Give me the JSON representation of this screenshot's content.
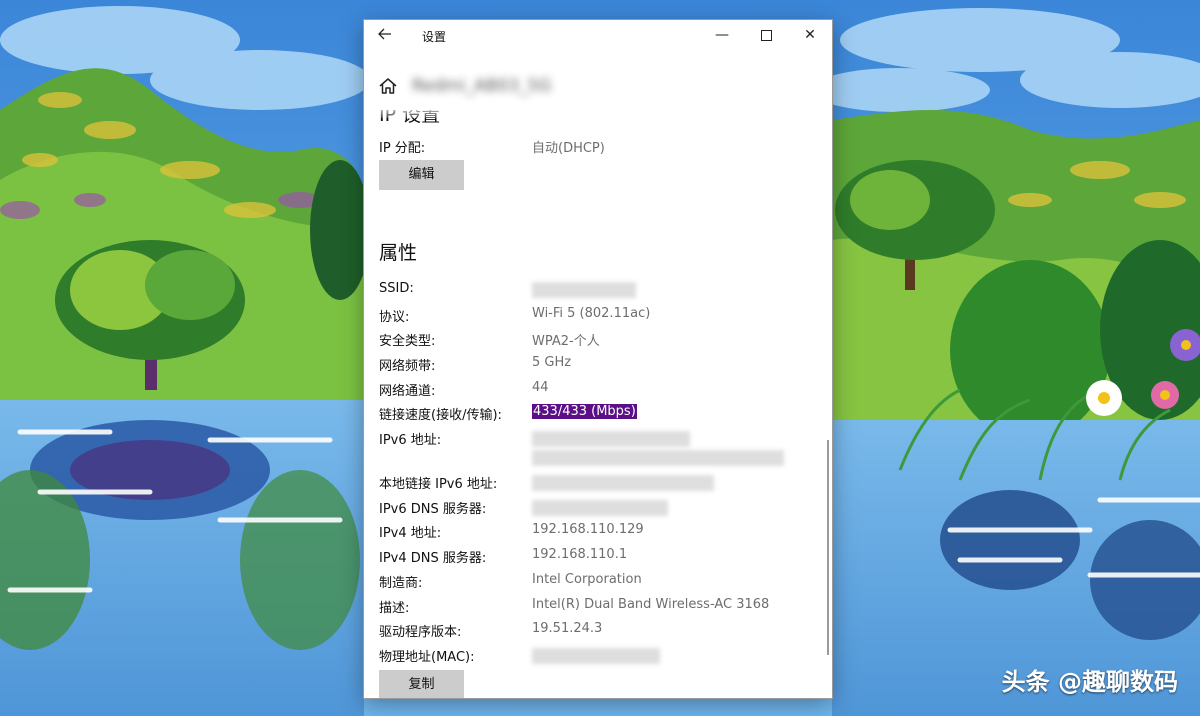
{
  "window": {
    "title": "设置",
    "back_icon": "arrow-left-icon",
    "minimize_symbol": "—",
    "close_symbol": "✕",
    "home_icon": "home-icon",
    "network_name": "Redmi_AB03_5G"
  },
  "ip_settings": {
    "heading": "IP 设置",
    "assignment_label": "IP 分配:",
    "assignment_value": "自动(DHCP)",
    "edit_button": "编辑"
  },
  "properties": {
    "heading": "属性",
    "rows": [
      {
        "label": "SSID:",
        "value": ""
      },
      {
        "label": "协议:",
        "value": "Wi-Fi 5 (802.11ac)"
      },
      {
        "label": "安全类型:",
        "value": "WPA2-个人"
      },
      {
        "label": "网络频带:",
        "value": "5 GHz"
      },
      {
        "label": "网络通道:",
        "value": "44"
      },
      {
        "label": "链接速度(接收/传输):",
        "value": "433/433 (Mbps)"
      },
      {
        "label": "IPv6 地址:",
        "value": ""
      },
      {
        "label": "本地链接 IPv6 地址:",
        "value": ""
      },
      {
        "label": "IPv6 DNS 服务器:",
        "value": ""
      },
      {
        "label": "IPv4 地址:",
        "value": "192.168.110.129"
      },
      {
        "label": "IPv4 DNS 服务器:",
        "value": "192.168.110.1"
      },
      {
        "label": "制造商:",
        "value": "Intel Corporation"
      },
      {
        "label": "描述:",
        "value": "Intel(R) Dual Band Wireless-AC 3168"
      },
      {
        "label": "驱动程序版本:",
        "value": "19.51.24.3"
      },
      {
        "label": "物理地址(MAC):",
        "value": ""
      }
    ],
    "copy_button": "复制"
  },
  "watermark": "头条 @趣聊数码",
  "colors": {
    "selection": "#5b0f86",
    "button_bg": "#cccccc",
    "value_text": "#6d6d6d"
  }
}
